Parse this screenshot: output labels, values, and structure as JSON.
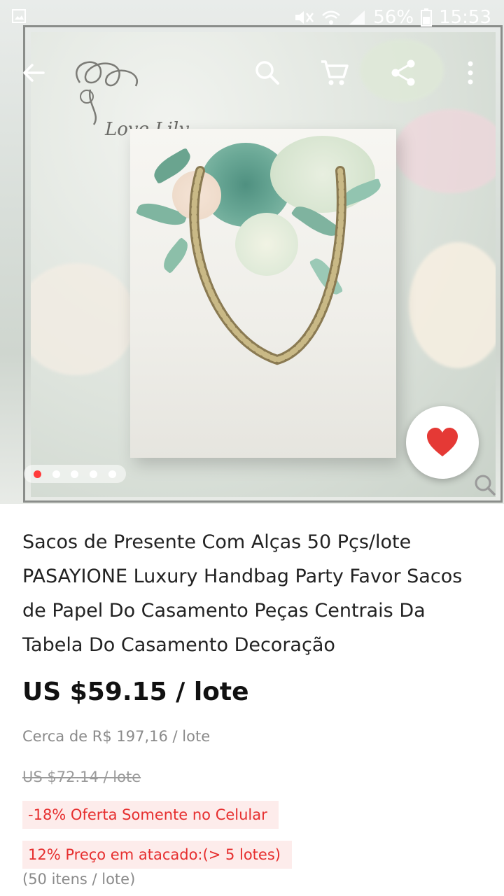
{
  "status_bar": {
    "battery": "56%",
    "time": "15:53",
    "icons": [
      "image-icon",
      "mute-icon",
      "wifi-icon",
      "signal-icon",
      "battery-icon"
    ]
  },
  "toolbar": {
    "icons": [
      "back-arrow-icon",
      "search-icon",
      "cart-icon",
      "share-icon",
      "more-vertical-icon"
    ]
  },
  "hero": {
    "logo_text": "Love Lily",
    "pager_count": 5,
    "pager_active": 0,
    "favorite_icon": "heart-icon",
    "zoom_icon": "zoom-icon"
  },
  "product": {
    "title": "Sacos de Presente Com Alças 50 Pçs/lote PASAYIONE Luxury Handbag Party Favor Sacos de Papel Do Casamento Peças Centrais Da Tabela Do Casamento Decoração",
    "price": "US $59.15 / lote",
    "approx_price": "Cerca de R$ 197,16 / lote",
    "original_price": "US $72.14 / lote",
    "promo_mobile": "-18% Oferta Somente no Celular",
    "promo_wholesale": "12% Preço em atacado:(> 5 lotes)",
    "units": "(50 itens / lote)"
  },
  "colors": {
    "accent_red": "#e62e2e",
    "heart_red": "#e53935",
    "promo_bg": "#fdeceb"
  }
}
